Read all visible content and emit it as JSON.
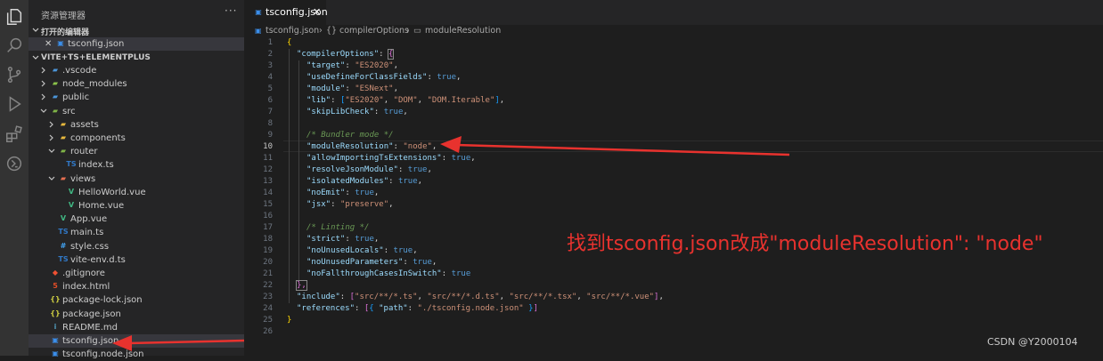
{
  "sidebar": {
    "title": "资源管理器",
    "more": "···",
    "open_editors": {
      "header": "打开的编辑器",
      "file": "tsconfig.json",
      "close": "✕"
    },
    "project": {
      "header": "VITE+TS+ELEMENTPLUS",
      "items": [
        {
          "label": ".vscode",
          "kind": "folder"
        },
        {
          "label": "node_modules",
          "kind": "folder"
        },
        {
          "label": "public",
          "kind": "folder"
        },
        {
          "label": "src",
          "kind": "folder-open"
        },
        {
          "label": "assets",
          "kind": "folder"
        },
        {
          "label": "components",
          "kind": "folder"
        },
        {
          "label": "router",
          "kind": "folder-open"
        },
        {
          "label": "index.ts",
          "kind": "ts"
        },
        {
          "label": "views",
          "kind": "folder-open"
        },
        {
          "label": "HelloWorld.vue",
          "kind": "vue"
        },
        {
          "label": "Home.vue",
          "kind": "vue"
        },
        {
          "label": "App.vue",
          "kind": "vue"
        },
        {
          "label": "main.ts",
          "kind": "ts"
        },
        {
          "label": "style.css",
          "kind": "css"
        },
        {
          "label": "vite-env.d.ts",
          "kind": "ts"
        },
        {
          "label": ".gitignore",
          "kind": "git"
        },
        {
          "label": "index.html",
          "kind": "html"
        },
        {
          "label": "package-lock.json",
          "kind": "json"
        },
        {
          "label": "package.json",
          "kind": "json"
        },
        {
          "label": "README.md",
          "kind": "info"
        },
        {
          "label": "tsconfig.json",
          "kind": "tsconfig"
        },
        {
          "label": "tsconfig.node.json",
          "kind": "tsconfig"
        }
      ]
    }
  },
  "tab": {
    "label": "tsconfig.json",
    "close": "✕"
  },
  "breadcrumb": {
    "file": "tsconfig.json",
    "sep": "›",
    "node1": "compilerOptions",
    "node2": "moduleResolution"
  },
  "code": {
    "line_numbers": [
      "1",
      "2",
      "3",
      "4",
      "5",
      "6",
      "7",
      "8",
      "9",
      "10",
      "11",
      "12",
      "13",
      "14",
      "15",
      "16",
      "17",
      "18",
      "19",
      "20",
      "21",
      "22",
      "23",
      "24",
      "25",
      "26"
    ],
    "active_line": "10",
    "lines": {
      "l1_open": "{",
      "l2_key": "\"compilerOptions\"",
      "l2_colon": ": ",
      "l2_brace": "{",
      "l3_key": "\"target\"",
      "l3_val": "\"ES2020\"",
      "l4_key": "\"useDefineForClassFields\"",
      "l4_val": "true",
      "l5_key": "\"module\"",
      "l5_val": "\"ESNext\"",
      "l6_key": "\"lib\"",
      "l6_v1": "\"ES2020\"",
      "l6_v2": "\"DOM\"",
      "l6_v3": "\"DOM.Iterable\"",
      "l7_key": "\"skipLibCheck\"",
      "l7_val": "true",
      "l9_comment": "/* Bundler mode */",
      "l10_key": "\"moduleResolution\"",
      "l10_val": "\"node\"",
      "l11_key": "\"allowImportingTsExtensions\"",
      "l11_val": "true",
      "l12_key": "\"resolveJsonModule\"",
      "l12_val": "true",
      "l13_key": "\"isolatedModules\"",
      "l13_val": "true",
      "l14_key": "\"noEmit\"",
      "l14_val": "true",
      "l15_key": "\"jsx\"",
      "l15_val": "\"preserve\"",
      "l17_comment": "/* Linting */",
      "l18_key": "\"strict\"",
      "l18_val": "true",
      "l19_key": "\"noUnusedLocals\"",
      "l19_val": "true",
      "l20_key": "\"noUnusedParameters\"",
      "l20_val": "true",
      "l21_key": "\"noFallthroughCasesInSwitch\"",
      "l21_val": "true",
      "l22_close": "},",
      "l23_key": "\"include\"",
      "l23_v1": "\"src/**/*.ts\"",
      "l23_v2": "\"src/**/*.d.ts\"",
      "l23_v3": "\"src/**/*.tsx\"",
      "l23_v4": "\"src/**/*.vue\"",
      "l24_key": "\"references\"",
      "l24_pkey": "\"path\"",
      "l24_pval": "\"./tsconfig.node.json\"",
      "l25_close": "}"
    }
  },
  "annotation": "找到tsconfig.json改成\"moduleResolution\": \"node\"",
  "watermark": "CSDN @Y2000104",
  "colors": {
    "arrow": "#e8322e",
    "bg": "#1e1e1e",
    "sidebar": "#252526",
    "activity": "#333333"
  }
}
